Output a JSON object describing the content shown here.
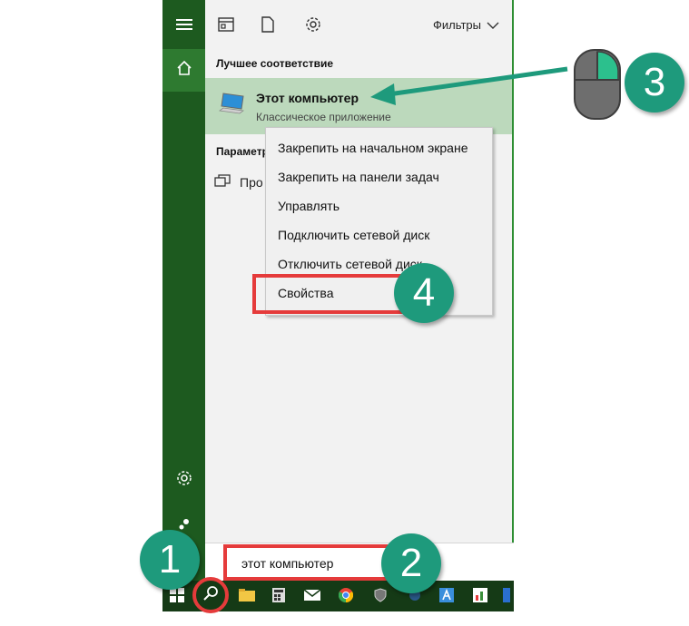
{
  "toolbar": {
    "filters_label": "Фильтры"
  },
  "best_match": {
    "section_title": "Лучшее соответствие",
    "title": "Этот компьютер",
    "subtitle": "Классическое приложение"
  },
  "settings": {
    "section_title": "Параметр",
    "item_label": "Про"
  },
  "context_menu": {
    "items": [
      "Закрепить на начальном экране",
      "Закрепить на панели задач",
      "Управлять",
      "Подключить сетевой диск",
      "Отключить сетевой диск",
      "Свойства"
    ]
  },
  "search": {
    "value": "этот компьютер"
  },
  "badges": {
    "b1": "1",
    "b2": "2",
    "b3": "3",
    "b4": "4"
  },
  "colors": {
    "rail": "#1d5a1f",
    "accent_green": "#2f8f34",
    "best_match_bg": "#bcd9bc",
    "badge": "#1e9a7c",
    "highlight_red": "#e53b3b"
  }
}
